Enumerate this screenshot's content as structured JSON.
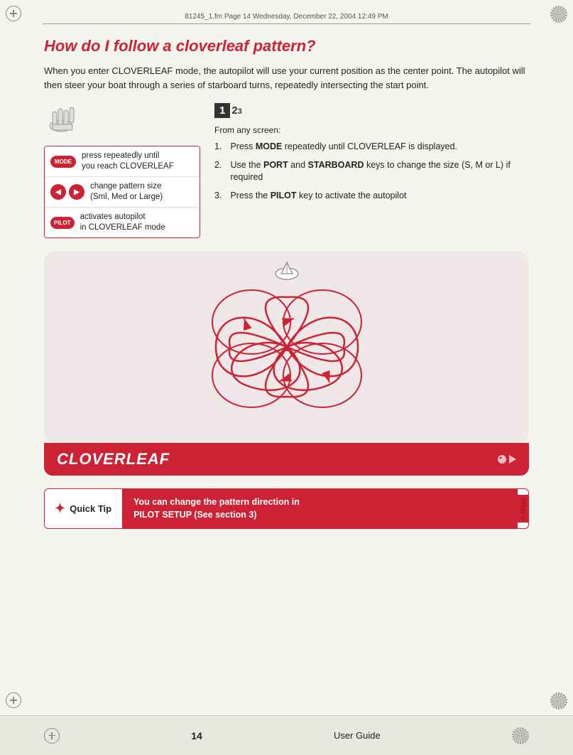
{
  "meta": {
    "file_info": "81245_1.fm  Page 14  Wednesday, December 22, 2004  12:49 PM"
  },
  "header": {
    "title": "How do I follow a cloverleaf pattern?"
  },
  "intro": {
    "text": "When you enter CLOVERLEAF mode, the autopilot will use your current position as the center point. The autopilot will then steer your boat through a series of starboard turns, repeatedly intersecting the start point."
  },
  "key_legend": {
    "rows": [
      {
        "key": "MODE",
        "desc_line1": "press repeatedly until",
        "desc_line2": "you reach CLOVERLEAF"
      },
      {
        "key": "◁  ▷",
        "desc_line1": "change pattern size",
        "desc_line2": "(Sml, Med or Large)"
      },
      {
        "key": "PILOT",
        "desc_line1": "activates autopilot",
        "desc_line2": "in CLOVERLEAF mode"
      }
    ]
  },
  "steps": {
    "from_screen_label": "From any screen:",
    "items": [
      {
        "text_before": "Press ",
        "bold": "MODE",
        "text_after": " repeatedly until CLOVERLEAF is displayed."
      },
      {
        "text_before": "Use the ",
        "bold1": "PORT",
        "text_mid": " and ",
        "bold2": "STARBOARD",
        "text_after": " keys to change the size (S, M or L) if required"
      },
      {
        "text_before": "Press the ",
        "bold": "PILOT",
        "text_after": " key to activate the autopilot"
      }
    ]
  },
  "diagram": {
    "label": "CLOVERLEAF"
  },
  "quick_tip": {
    "label": "Quick Tip",
    "text_line1": "You can change the pattern direction in",
    "text_line2": "PILOT SETUP (See section 3)",
    "code": "D7622-1"
  },
  "footer": {
    "page_number": "14",
    "guide_label": "User Guide"
  }
}
